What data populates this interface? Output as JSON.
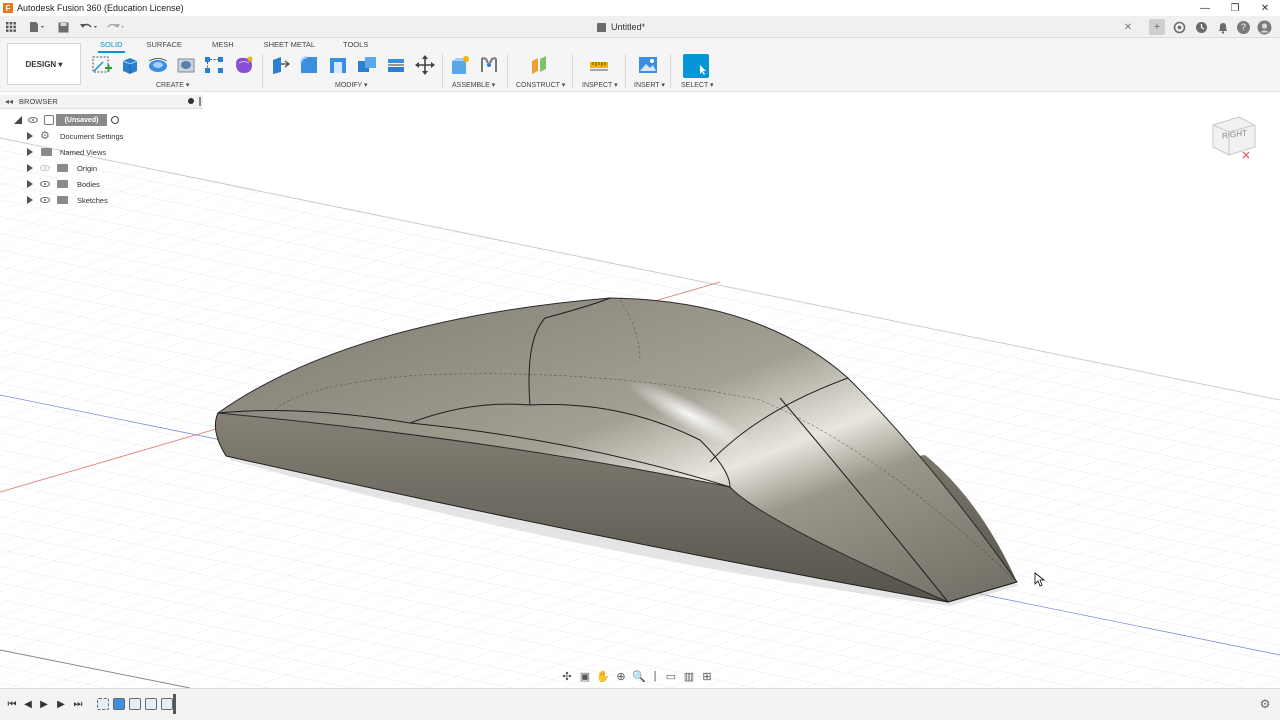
{
  "window": {
    "title": "Autodesk Fusion 360 (Education License)",
    "document_tab": "Untitled*"
  },
  "workspace": {
    "label": "DESIGN ▾"
  },
  "tabs": [
    "SOLID",
    "SURFACE",
    "MESH",
    "SHEET METAL",
    "TOOLS"
  ],
  "active_tab": "SOLID",
  "groups": {
    "create": "CREATE ▾",
    "modify": "MODIFY ▾",
    "assemble": "ASSEMBLE ▾",
    "construct": "CONSTRUCT ▾",
    "inspect": "INSPECT ▾",
    "insert": "INSERT ▾",
    "select": "SELECT ▾"
  },
  "browser": {
    "title": "BROWSER",
    "root": "(Unsaved)",
    "items": [
      "Document Settings",
      "Named Views",
      "Origin",
      "Bodies",
      "Sketches"
    ]
  },
  "viewcube": {
    "face": "RIGHT"
  },
  "colors": {
    "accent": "#0696d7",
    "body": "#9a968a",
    "grid": "#d9dde2",
    "x_axis": "#e07070",
    "y_axis": "#7d8fd8"
  }
}
